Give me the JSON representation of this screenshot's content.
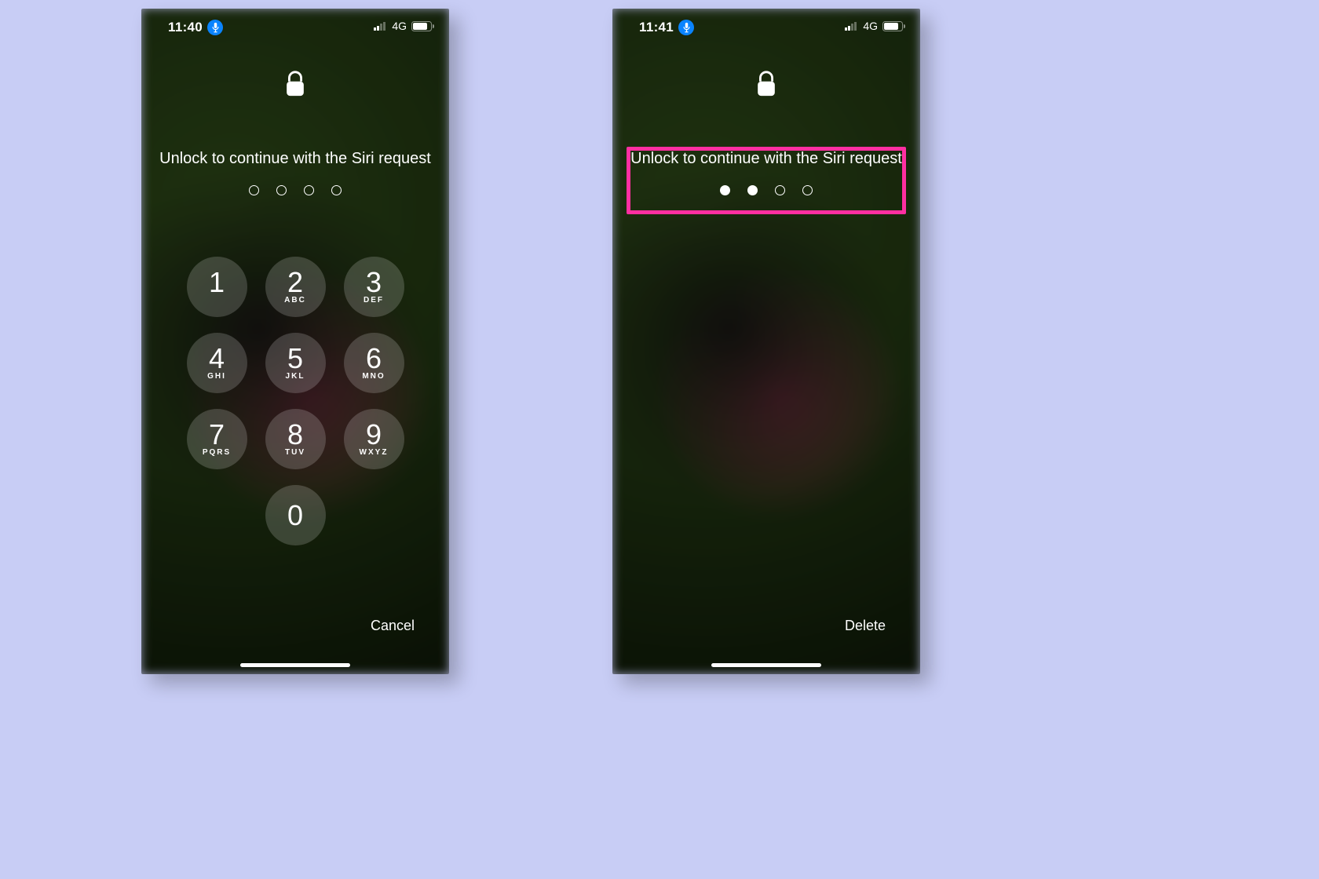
{
  "screens": [
    {
      "id": "passcode-keypad",
      "status_bar": {
        "time": "11:40",
        "network_label": "4G",
        "mic_active": true,
        "cell_bars": 2,
        "battery_pct": 80
      },
      "prompt": "Unlock to continue with the Siri request",
      "passcode": {
        "length": 4,
        "entered": 0
      },
      "keypad_visible": true,
      "bottom_action_label": "Cancel",
      "highlight": null
    },
    {
      "id": "passcode-entering",
      "status_bar": {
        "time": "11:41",
        "network_label": "4G",
        "mic_active": true,
        "cell_bars": 2,
        "battery_pct": 80
      },
      "prompt": "Unlock to continue with the Siri request",
      "passcode": {
        "length": 4,
        "entered": 2
      },
      "keypad_visible": false,
      "bottom_action_label": "Delete",
      "highlight": {
        "target": "prompt-zone"
      }
    }
  ],
  "keypad": [
    {
      "digit": "1",
      "letters": ""
    },
    {
      "digit": "2",
      "letters": "ABC"
    },
    {
      "digit": "3",
      "letters": "DEF"
    },
    {
      "digit": "4",
      "letters": "GHI"
    },
    {
      "digit": "5",
      "letters": "JKL"
    },
    {
      "digit": "6",
      "letters": "MNO"
    },
    {
      "digit": "7",
      "letters": "PQRS"
    },
    {
      "digit": "8",
      "letters": "TUV"
    },
    {
      "digit": "9",
      "letters": "WXYZ"
    },
    {
      "digit": "0",
      "letters": ""
    }
  ],
  "colors": {
    "highlight": "#ff2fa1",
    "accent_mic": "#0a84ff",
    "page_bg": "#c8cdf5"
  }
}
